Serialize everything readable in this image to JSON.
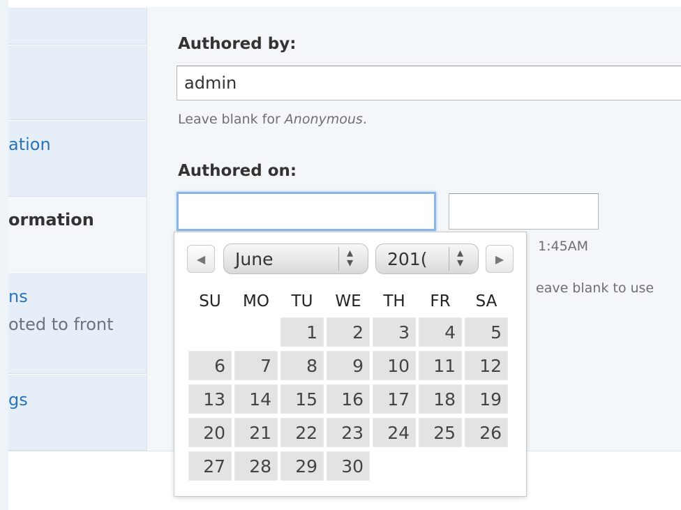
{
  "sidebar": {
    "tabs": [
      {
        "label": "",
        "sub": ""
      },
      {
        "label": "ation",
        "sub": ""
      },
      {
        "label": "ormation",
        "sub": ""
      },
      {
        "label": "ns",
        "sub": "oted to front"
      },
      {
        "label": "gs",
        "sub": ""
      }
    ]
  },
  "form": {
    "authored_by_label": "Authored by:",
    "authored_by_value": "admin",
    "authored_by_desc_prefix": "Leave blank for ",
    "authored_by_desc_em": "Anonymous",
    "authored_by_desc_suffix": ".",
    "authored_on_label": "Authored on:",
    "date_value": "",
    "time_value": "",
    "time_hint_partial": "1:45AM",
    "blank_hint_partial": "eave blank to use"
  },
  "calendar": {
    "month": "June",
    "year": "201(",
    "weekdays": [
      "SU",
      "MO",
      "TU",
      "WE",
      "TH",
      "FR",
      "SA"
    ],
    "first_weekday_index": 2,
    "days_in_month": 30
  }
}
